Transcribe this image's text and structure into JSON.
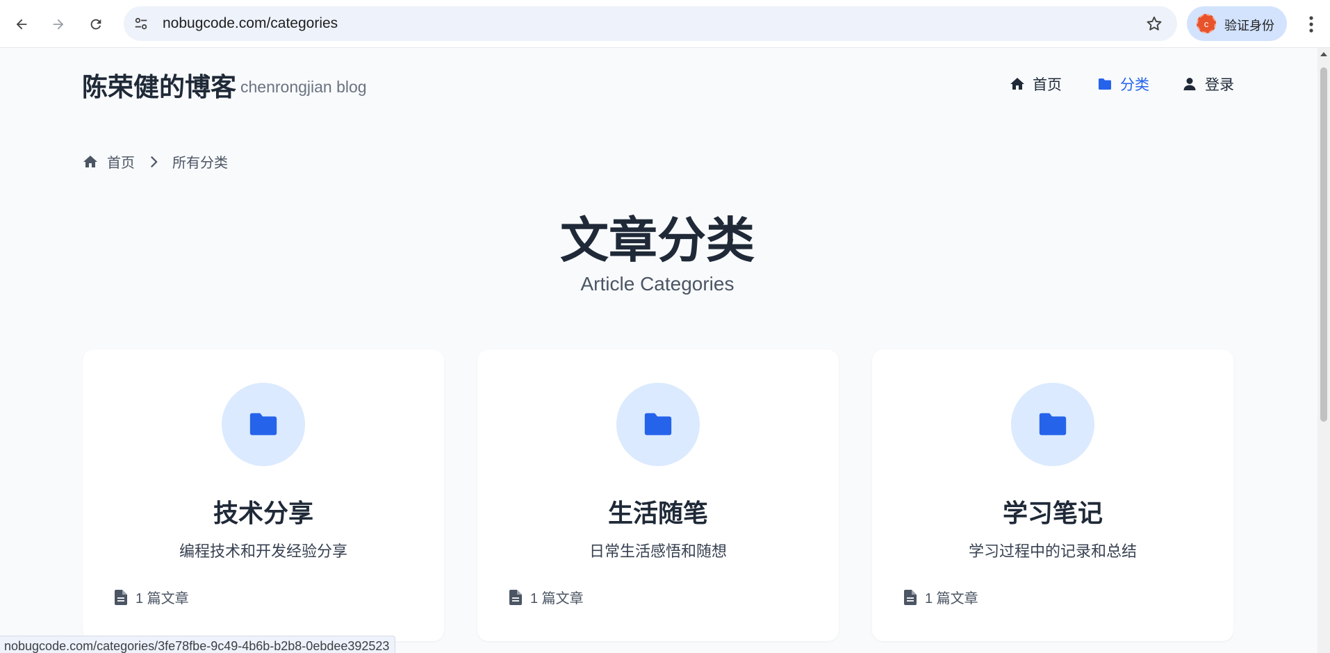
{
  "browser": {
    "url": "nobugcode.com/categories",
    "profile_label": "验证身份",
    "profile_initial": "c",
    "status_url": "nobugcode.com/categories/3fe78fbe-9c49-4b6b-b2b8-0ebdee392523"
  },
  "site": {
    "title": "陈荣健的博客",
    "subtitle": "chenrongjian blog"
  },
  "nav": {
    "home": "首页",
    "categories": "分类",
    "login": "登录"
  },
  "breadcrumb": {
    "home": "首页",
    "current": "所有分类"
  },
  "page": {
    "title": "文章分类",
    "subtitle": "Article Categories"
  },
  "categories": [
    {
      "name": "技术分享",
      "description": "编程技术和开发经验分享",
      "count": "1 篇文章"
    },
    {
      "name": "生活随笔",
      "description": "日常生活感悟和随想",
      "count": "1 篇文章"
    },
    {
      "name": "学习笔记",
      "description": "学习过程中的记录和总结",
      "count": "1 篇文章"
    }
  ],
  "colors": {
    "accent": "#2563eb",
    "icon_bg": "#dbeafe",
    "page_bg": "#f8fafc"
  },
  "icons": {
    "back": "arrow-left-icon",
    "forward": "arrow-right-icon",
    "reload": "reload-icon",
    "site_info": "tune-icon",
    "bookmark": "star-icon",
    "menu": "kebab-menu-icon",
    "home": "home-icon",
    "categories": "folder-icon",
    "login": "user-icon",
    "breadcrumb_sep": "chevron-right-icon",
    "article": "document-icon"
  }
}
